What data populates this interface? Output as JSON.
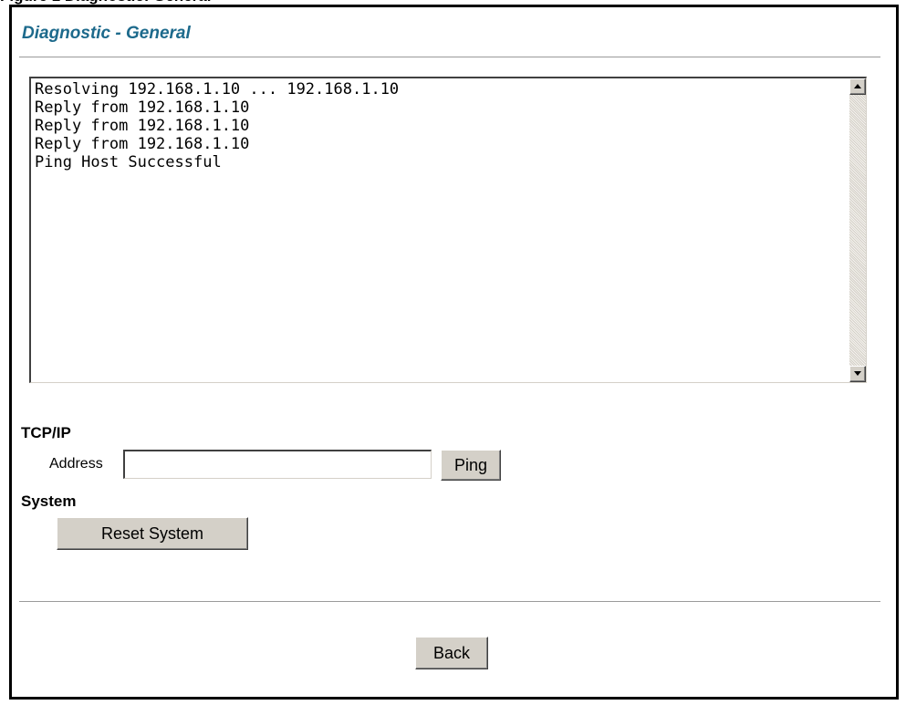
{
  "title": "Diagnostic - General",
  "log": {
    "lines": [
      "Resolving 192.168.1.10 ... 192.168.1.10",
      "Reply from 192.168.1.10",
      "Reply from 192.168.1.10",
      "Reply from 192.168.1.10",
      "Ping Host Successful"
    ]
  },
  "tcpip": {
    "heading": "TCP/IP",
    "address_label": "Address",
    "address_value": "",
    "ping_label": "Ping"
  },
  "system": {
    "heading": "System",
    "reset_label": "Reset System"
  },
  "footer": {
    "back_label": "Back"
  },
  "colors": {
    "title": "#1d6a8c",
    "button_face": "#d4d0c8"
  }
}
